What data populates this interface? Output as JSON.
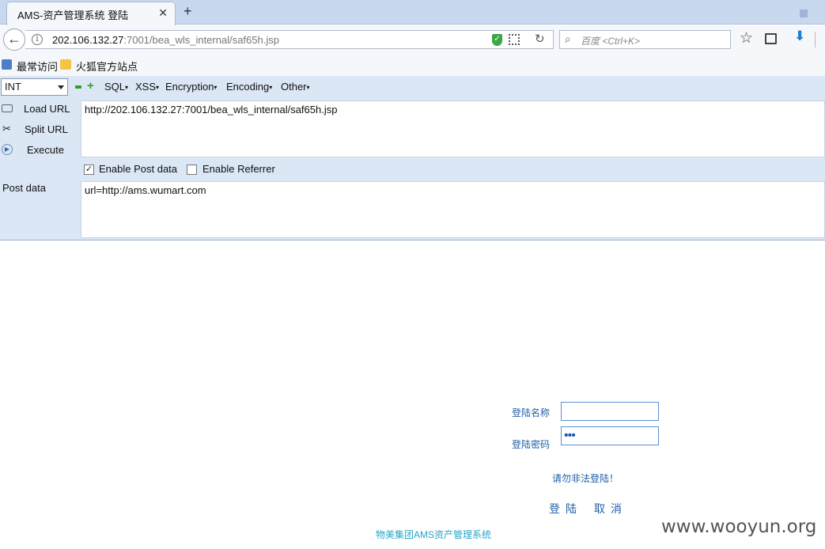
{
  "browser": {
    "tab_title": "AMS-资产管理系统 登陆",
    "url_host": "202.106.132.27",
    "url_path": ":7001/bea_wls_internal/saf65h.jsp",
    "search_placeholder": "百度 <Ctrl+K>",
    "bookmarks": [
      "最常访问",
      "火狐官方站点"
    ]
  },
  "hackbar": {
    "select_value": "INT",
    "menus": [
      "SQL",
      "XSS",
      "Encryption",
      "Encoding",
      "Other"
    ],
    "side_buttons": [
      "Load URL",
      "Split URL",
      "Execute"
    ],
    "url_value": "http://202.106.132.27:7001/bea_wls_internal/saf65h.jsp",
    "enable_post_label": "Enable Post data",
    "enable_post_checked": true,
    "enable_referrer_label": "Enable Referrer",
    "enable_referrer_checked": false,
    "post_data_label": "Post data",
    "post_data_value": "url=http://ams.wumart.com"
  },
  "login": {
    "username_label": "登陆名称",
    "password_label": "登陆密码",
    "password_dots": "•••",
    "warning": "请勿非法登陆！",
    "login_button": "登陆",
    "cancel_button": "取消",
    "footer": "物美集团AMS资产管理系统"
  },
  "watermark": "www.wooyun.org",
  "colors": {
    "link_blue": "#1f5fa8",
    "footer_cyan": "#27a5c8",
    "hackbar_bg": "#dbe7f5",
    "shield_green": "#3aa842"
  }
}
